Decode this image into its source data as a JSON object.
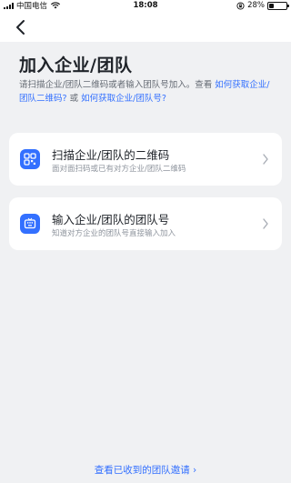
{
  "status": {
    "carrier": "中国电信",
    "time": "18:08",
    "battery": "28%",
    "battery_level": 0.28
  },
  "header": {
    "back_icon": "chevron-left-icon"
  },
  "main": {
    "title": "加入企业/团队",
    "description_text": "请扫描企业/团队二维码或者输入团队号加入。查看",
    "link_qr": "如何获取企业/团队二维码?",
    "or_text": "或",
    "link_team_no": "如何获取企业/团队号?"
  },
  "options": [
    {
      "icon": "qr-scan-icon",
      "title": "扫描企业/团队的二维码",
      "subtitle": "面对面扫码或已有对方企业/团队二维码"
    },
    {
      "icon": "keyboard-input-icon",
      "title": "输入企业/团队的团队号",
      "subtitle": "知道对方企业的团队号直接输入加入"
    }
  ],
  "footer": {
    "invite_link": "查看已收到的团队邀请 ›"
  },
  "colors": {
    "accent": "#3370ff",
    "background": "#f0f1f3"
  }
}
